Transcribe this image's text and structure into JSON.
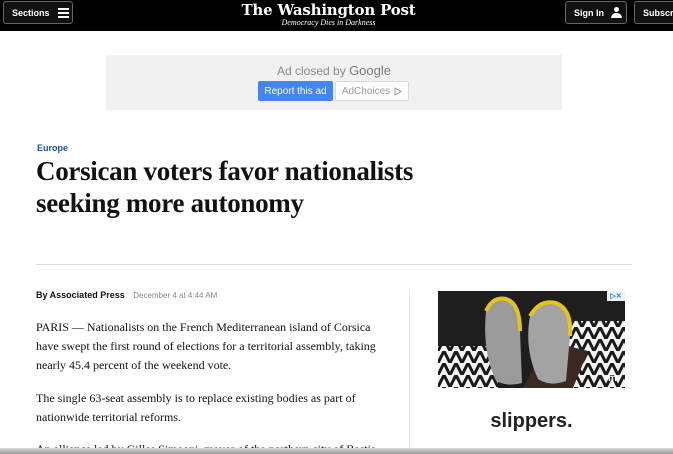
{
  "nav": {
    "sections_label": "Sections",
    "logo": "The Washington Post",
    "tagline": "Democracy Dies in Darkness",
    "signin_label": "Sign In",
    "subscribe_label": "Subscri"
  },
  "ad_notice": {
    "closed_prefix": "Ad closed by",
    "closed_brand": "Google",
    "report_label": "Report this ad",
    "adchoices_label": "AdChoices"
  },
  "article": {
    "kicker": "Europe",
    "headline": "Corsican voters favor nationalists seeking more autonomy",
    "author": "By Associated Press",
    "date": "December 4 at 4:44 AM",
    "paragraphs": [
      "PARIS — Nationalists on the French Mediterranean island of Corsica have swept the first round of elections for a territorial assembly, taking nearly 45.4 percent of the weekend vote.",
      "The single 63-seat assembly is to replace existing bodies as part of nationwide territorial reforms.",
      "An alliance led by Gilles Simeoni, mayor of the northern city of Bastia"
    ]
  },
  "rail_ad": {
    "caption": "slippers."
  },
  "colors": {
    "topbar": "#000000",
    "kicker": "#1955a5",
    "report_button": "#4285f4",
    "ad_background": "#f1f1f1"
  }
}
